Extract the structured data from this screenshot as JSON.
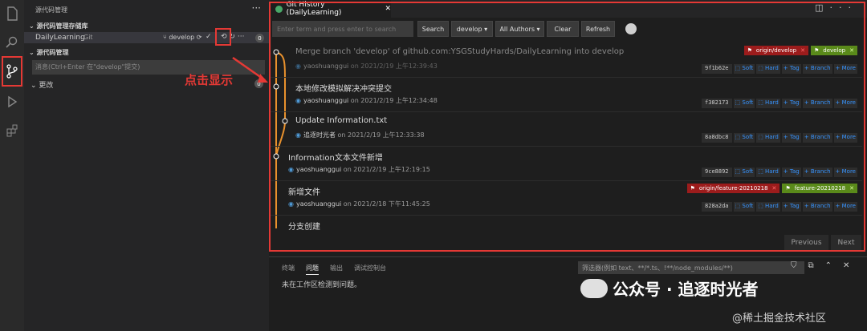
{
  "sidebar": {
    "title": "源代码管理",
    "section_repos": "源代码管理存储库",
    "repo_name": "DailyLearning",
    "repo_type": "Git",
    "repo_branch": "develop",
    "repo_count": "0",
    "section_scm": "源代码管理",
    "message_placeholder": "消息(Ctrl+Enter 在\"develop\"提交)",
    "changes_label": "更改",
    "changes_count": "0"
  },
  "annotation": {
    "text": "点击显示"
  },
  "tab": {
    "title": "Git History (DailyLearning)"
  },
  "toolbar": {
    "search_placeholder": "Enter term and press enter to search",
    "search_label": "Search",
    "branch_label": "develop ▾",
    "authors_label": "All Authors ▾",
    "clear_label": "Clear",
    "refresh_label": "Refresh"
  },
  "commits": [
    {
      "title": "Merge branch 'develop' of github.com:YSGStudyHards/DailyLearning into develop",
      "author": "yaoshuanggui",
      "date": "on 2021/2/19 上午12:39:43",
      "hash": "9f1b62e"
    },
    {
      "title": "本地修改模拟解决冲突提交",
      "author": "yaoshuanggui",
      "date": "on 2021/2/19 上午12:34:48",
      "hash": "f382173"
    },
    {
      "title": "Update Information.txt",
      "author": "追逐时光者",
      "date": "on 2021/2/19 上午12:33:38",
      "hash": "8a8dbc8"
    },
    {
      "title": "Information文本文件新增",
      "author": "yaoshuanggui",
      "date": "on 2021/2/19 上午12:19:15",
      "hash": "9ce8892"
    },
    {
      "title": "新增文件",
      "author": "yaoshuanggui",
      "date": "on 2021/2/18 下午11:45:25",
      "hash": "828a2da"
    },
    {
      "title": "分支创建",
      "author": "",
      "date": "",
      "hash": ""
    }
  ],
  "actions": {
    "soft": "Soft",
    "hard": "Hard",
    "tag": "Tag",
    "branch": "Branch",
    "more": "More"
  },
  "refs": {
    "commit0_origin": "origin/develop",
    "commit0_local": "develop",
    "commit4_origin": "origin/feature-20210218",
    "commit4_local": "feature-20210218"
  },
  "pager": {
    "previous": "Previous",
    "next": "Next"
  },
  "panel": {
    "tab_terminal": "终端",
    "tab_problems": "问题",
    "tab_output": "输出",
    "tab_debug": "调试控制台",
    "filter_placeholder": "筛选器(例如 text、**/*.ts、!**/node_modules/**)",
    "message": "未在工作区检测到问题。"
  },
  "watermark": {
    "main": "公众号 · 追逐时光者",
    "sub": "@稀土掘金技术社区"
  },
  "colors": {
    "accent_red": "#e53935",
    "tag_green": "#5a8a1a",
    "tag_red": "#9c1c1c",
    "graph_orange": "#e8912d"
  }
}
